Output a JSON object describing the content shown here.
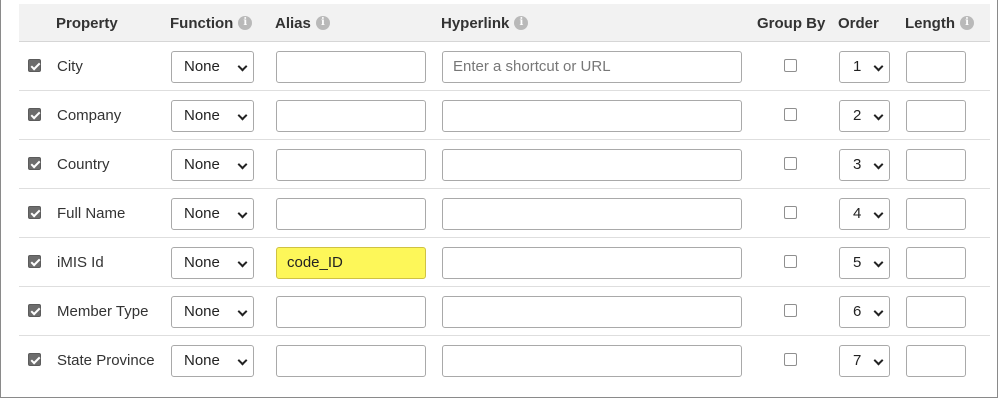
{
  "headers": {
    "property": "Property",
    "function": "Function",
    "alias": "Alias",
    "hyperlink": "Hyperlink",
    "group_by": "Group By",
    "order": "Order",
    "length": "Length",
    "info_glyph": "i"
  },
  "rows": [
    {
      "checked": true,
      "property": "City",
      "function": "None",
      "alias": "",
      "hyperlink": "",
      "hyperlink_placeholder": "Enter a shortcut or URL",
      "group_by": false,
      "order": "1",
      "length": ""
    },
    {
      "checked": true,
      "property": "Company",
      "function": "None",
      "alias": "",
      "hyperlink": "",
      "hyperlink_placeholder": "",
      "group_by": false,
      "order": "2",
      "length": ""
    },
    {
      "checked": true,
      "property": "Country",
      "function": "None",
      "alias": "",
      "hyperlink": "",
      "hyperlink_placeholder": "",
      "group_by": false,
      "order": "3",
      "length": ""
    },
    {
      "checked": true,
      "property": "Full Name",
      "function": "None",
      "alias": "",
      "hyperlink": "",
      "hyperlink_placeholder": "",
      "group_by": false,
      "order": "4",
      "length": ""
    },
    {
      "checked": true,
      "property": "iMIS Id",
      "function": "None",
      "alias": "code_ID",
      "alias_highlight": "#fdf759",
      "hyperlink": "",
      "hyperlink_placeholder": "",
      "group_by": false,
      "order": "5",
      "length": ""
    },
    {
      "checked": true,
      "property": "Member Type",
      "function": "None",
      "alias": "",
      "hyperlink": "",
      "hyperlink_placeholder": "",
      "group_by": false,
      "order": "6",
      "length": ""
    },
    {
      "checked": true,
      "property": "State Province",
      "function": "None",
      "alias": "",
      "hyperlink": "",
      "hyperlink_placeholder": "",
      "group_by": false,
      "order": "7",
      "length": ""
    }
  ]
}
